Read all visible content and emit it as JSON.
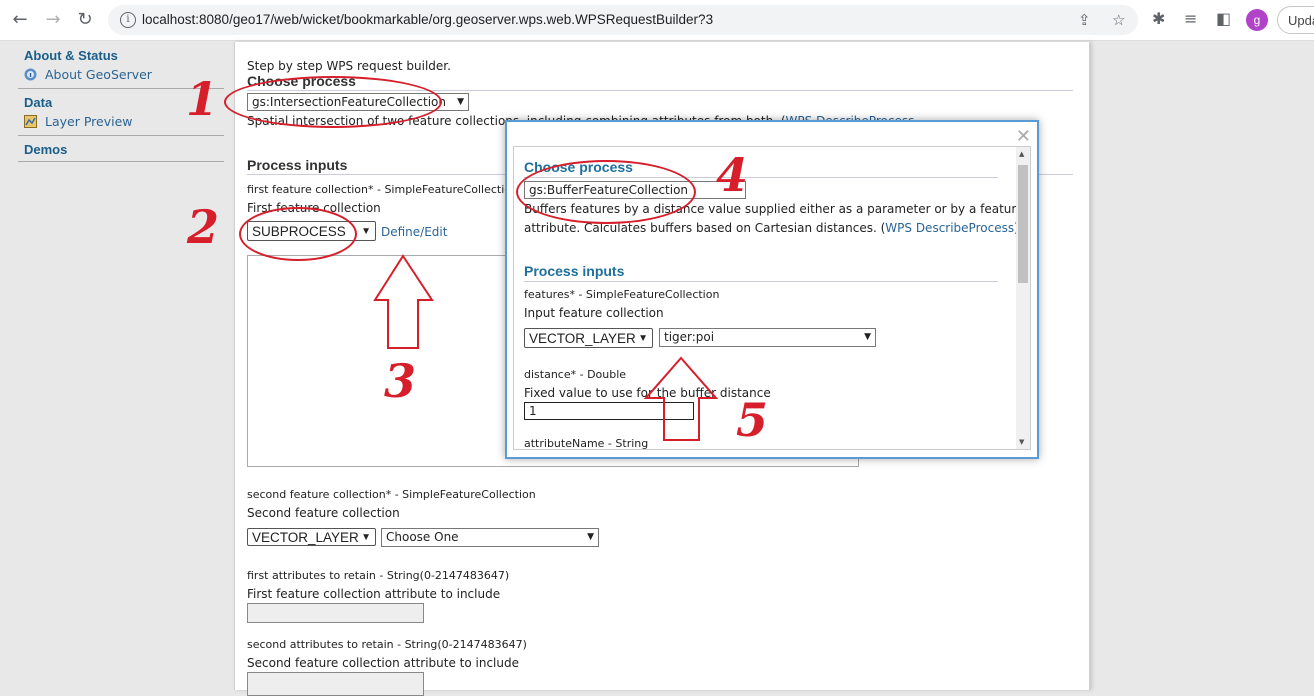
{
  "browser": {
    "url": "localhost:8080/geo17/web/wicket/bookmarkable/org.geoserver.wps.web.WPSRequestBuilder?3",
    "profile_initial": "g",
    "update_label": "Upda"
  },
  "sidebar": {
    "sections": [
      {
        "title": "About & Status",
        "items": [
          {
            "label": "About GeoServer",
            "icon": "info-icon"
          }
        ]
      },
      {
        "title": "Data",
        "items": [
          {
            "label": "Layer Preview",
            "icon": "layer-preview-icon"
          }
        ]
      },
      {
        "title": "Demos",
        "items": []
      }
    ]
  },
  "main": {
    "intro": "Step by step WPS request builder.",
    "choose_process_title": "Choose process",
    "process_value": "gs:IntersectionFeatureCollection",
    "process_description": "Spatial intersection of two feature collections, including combining attributes from both. (",
    "describe_link": "WPS DescribeProcess",
    "process_inputs_title": "Process inputs",
    "first_fc_label": "first feature collection* - SimpleFeatureCollection",
    "first_fc_desc": "First feature collection",
    "first_fc_type": "SUBPROCESS",
    "define_edit": "Define/Edit",
    "second_fc_label": "second feature collection* - SimpleFeatureCollection",
    "second_fc_desc": "Second feature collection",
    "second_fc_type": "VECTOR_LAYER",
    "second_fc_choice": "Choose One",
    "first_attr_label": "first attributes to retain - String(0-2147483647)",
    "first_attr_desc": "First feature collection attribute to include",
    "second_attr_label": "second attributes to retain - String(0-2147483647)",
    "second_attr_desc": "Second feature collection attribute to include"
  },
  "dialog": {
    "choose_process_title": "Choose process",
    "process_value": "gs:BufferFeatureCollection",
    "process_description_1": "Buffers features by a distance value supplied either as a parameter or by a feature",
    "process_description_2": "attribute. Calculates buffers based on Cartesian distances. (",
    "describe_link": "WPS DescribeProcess",
    "process_inputs_title": "Process inputs",
    "features_label": "features* - SimpleFeatureCollection",
    "features_desc": "Input feature collection",
    "features_type": "VECTOR_LAYER",
    "features_layer": "tiger:poi",
    "distance_label": "distance* - Double",
    "distance_desc": "Fixed value to use for the buffer distance",
    "distance_value": "1",
    "attribute_label": "attributeName - String"
  },
  "annotations": {
    "numbers": [
      "1",
      "2",
      "3",
      "4",
      "5"
    ],
    "color": "#d61f2b"
  }
}
